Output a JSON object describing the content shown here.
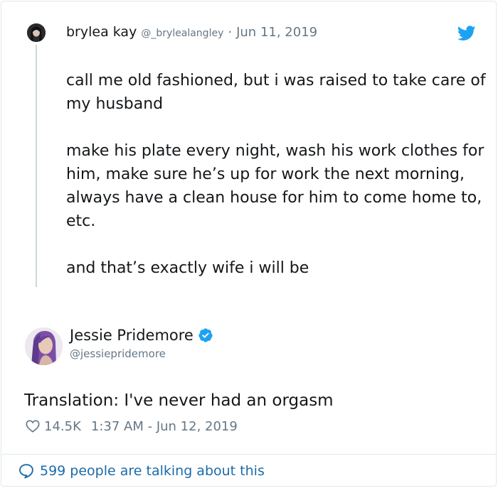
{
  "colors": {
    "text_primary": "#14171a",
    "text_secondary": "#657786",
    "twitter_blue": "#1da1f2",
    "link_blue": "#1b6ba8",
    "border": "#e1e8ed"
  },
  "quoted_tweet": {
    "author_name": "brylea kay",
    "author_handle": "@_brylealangley",
    "separator": "·",
    "date": "Jun 11, 2019",
    "avatar_icon": "profile-photo-icon",
    "platform_icon": "twitter-bird-icon",
    "paragraphs": [
      "call me old fashioned, but i was raised to take care of my husband",
      "make his plate every night, wash his work clothes for him, make sure he’s up for work the next morning, always have a clean house for him to come home to, etc.",
      "and that’s exactly wife i will be"
    ]
  },
  "reply_tweet": {
    "author_name": "Jessie Pridemore",
    "author_handle": "@jessiepridemore",
    "verified_icon": "verified-badge-icon",
    "text": "Translation: I've never had an orgasm",
    "like_icon": "heart-icon",
    "like_count": "14.5K",
    "timestamp": "1:37 AM - Jun 12, 2019"
  },
  "footer": {
    "icon": "speech-bubble-icon",
    "label": "599 people are talking about this"
  }
}
